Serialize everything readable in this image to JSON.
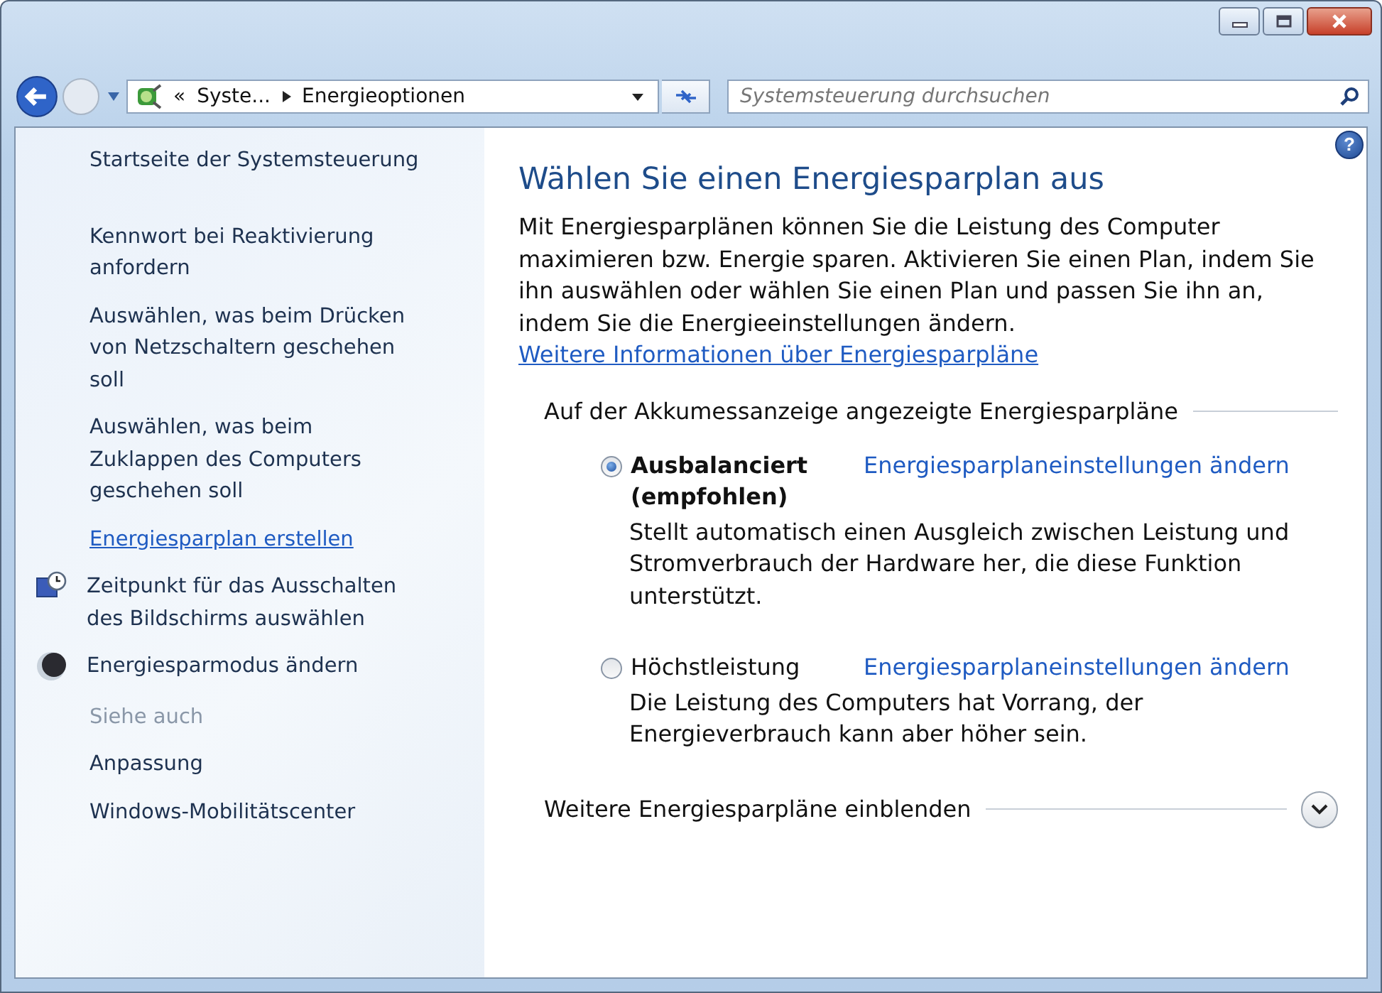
{
  "navigation": {
    "breadcrumb_overflow": "«",
    "breadcrumbs": [
      "Syste...",
      "Energieoptionen"
    ],
    "search": {
      "placeholder": "Systemsteuerung durchsuchen"
    }
  },
  "sidebar": {
    "items": [
      {
        "kind": "task",
        "label": "Startseite der Systemsteuerung"
      },
      {
        "kind": "task",
        "label": "Kennwort bei Reaktivierung anfordern"
      },
      {
        "kind": "task",
        "label": "Auswählen, was beim Drücken von Netzschaltern geschehen soll"
      },
      {
        "kind": "task",
        "label": "Auswählen, was beim Zuklappen des Computers geschehen soll"
      },
      {
        "kind": "link",
        "label": "Energiesparplan erstellen"
      },
      {
        "kind": "clock-task",
        "label": "Zeitpunkt für das Ausschalten des Bildschirms auswählen"
      },
      {
        "kind": "moon-task",
        "label": "Energiesparmodus ändern"
      },
      {
        "kind": "heading",
        "label": "Siehe auch"
      },
      {
        "kind": "task",
        "label": "Anpassung"
      },
      {
        "kind": "task",
        "label": "Windows-Mobilitätscenter"
      }
    ]
  },
  "main": {
    "help": "?",
    "title": "Wählen Sie einen Energiesparplan aus",
    "intro": "Mit Energiesparplänen können Sie die Leistung des Computer maximieren bzw. Energie sparen. Aktivieren Sie einen Plan, indem Sie ihn auswählen oder wählen Sie einen Plan und passen Sie ihn an, indem Sie die Energieeinstellungen ändern.",
    "intro_link": "Weitere Informationen über Energiesparpläne",
    "group_title": "Auf der Akkumessanzeige angezeigte Energiesparpläne",
    "plans": [
      {
        "name": "Ausbalanciert (empfohlen)",
        "selected": true,
        "settings_link": "Energiesparplaneinstellungen ändern",
        "description": "Stellt automatisch einen Ausgleich zwischen Leistung und Stromverbrauch der Hardware her, die diese Funktion unterstützt."
      },
      {
        "name": "Höchstleistung",
        "selected": false,
        "settings_link": "Energiesparplaneinstellungen ändern",
        "description": "Die Leistung des Computers hat Vorrang, der Energieverbrauch kann aber höher sein."
      }
    ],
    "more_plans": {
      "label": "Weitere Energiesparpläne einblenden",
      "expanded": false
    }
  }
}
